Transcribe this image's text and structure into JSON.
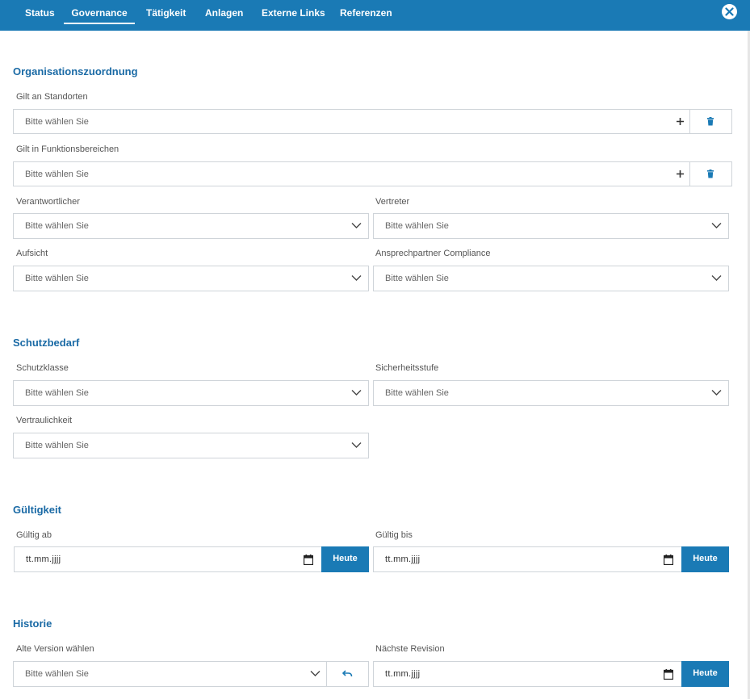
{
  "tabs": [
    {
      "label": "Status"
    },
    {
      "label": "Governance"
    },
    {
      "label": "Tätigkeit"
    },
    {
      "label": "Anlagen"
    },
    {
      "label": "Externe Links"
    },
    {
      "label": "Referenzen"
    }
  ],
  "active_tab": "Governance",
  "colors": {
    "accent": "#1a7ab5",
    "section_title": "#1a6aa5",
    "border": "#cfd4d9"
  },
  "placeholder": "Bitte wählen Sie",
  "date_placeholder": "tt.mm.jjjj",
  "today_label": "Heute",
  "sections": {
    "org": {
      "title": "Organisationszuordnung",
      "standorte_label": "Gilt an Standorten",
      "funktionsbereiche_label": "Gilt in Funktionsbereichen",
      "verantwortlicher_label": "Verantwortlicher",
      "vertreter_label": "Vertreter",
      "aufsicht_label": "Aufsicht",
      "compliance_label": "Ansprechpartner Compliance"
    },
    "schutz": {
      "title": "Schutzbedarf",
      "schutzklasse_label": "Schutzklasse",
      "sicherheitsstufe_label": "Sicherheitsstufe",
      "vertraulichkeit_label": "Vertraulichkeit"
    },
    "gueltig": {
      "title": "Gültigkeit",
      "ab_label": "Gültig ab",
      "bis_label": "Gültig bis"
    },
    "historie": {
      "title": "Historie",
      "version_label": "Alte Version wählen",
      "revision_label": "Nächste Revision"
    }
  }
}
